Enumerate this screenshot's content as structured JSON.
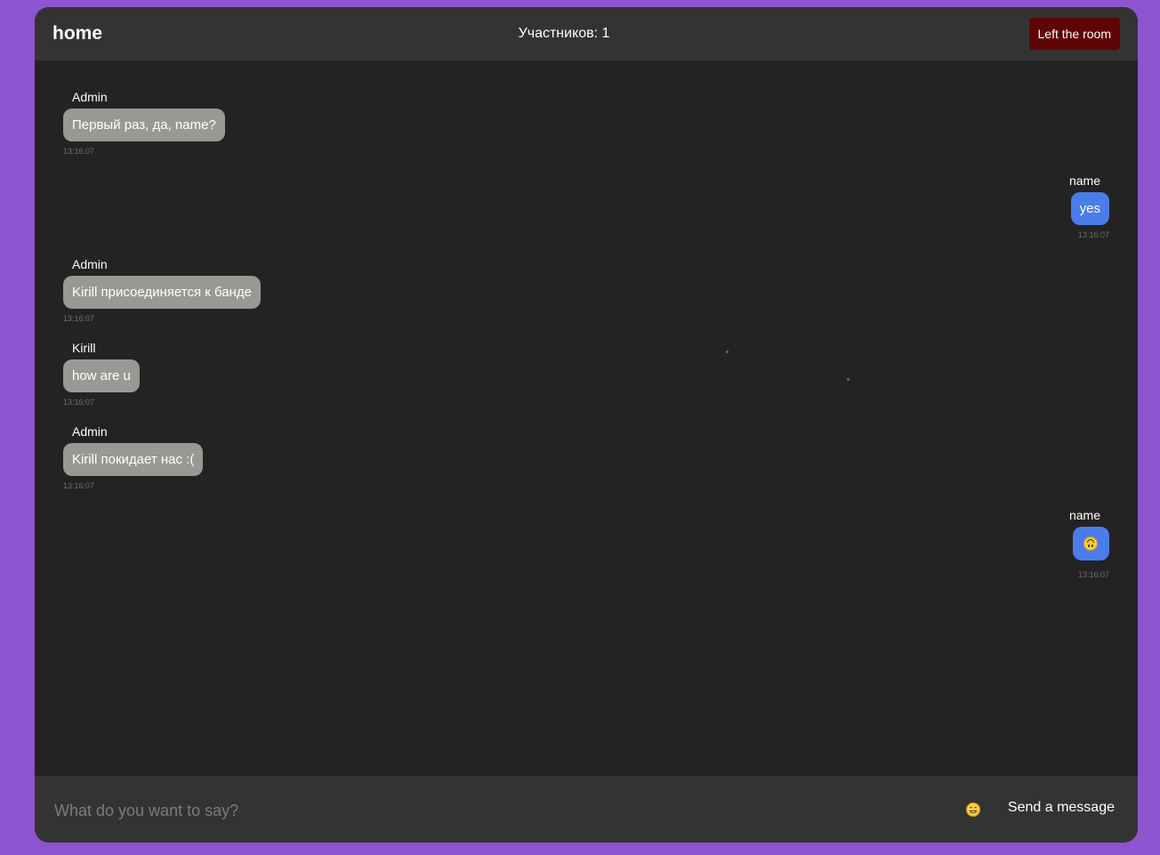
{
  "header": {
    "room_name": "home",
    "participants_label": "Участников: 1",
    "leave_label": "Left the room"
  },
  "messages": [
    {
      "author": "Admin",
      "text": "Первый раз, да, name?",
      "time": "13:16:07",
      "side": "left"
    },
    {
      "author": "name",
      "text": "yes",
      "time": "13:16:07",
      "side": "right"
    },
    {
      "author": "Admin",
      "text": "Kirill присоединяется к банде",
      "time": "13:16:07",
      "side": "left"
    },
    {
      "author": "Kirill",
      "text": "how are u",
      "time": "13:16:07",
      "side": "left"
    },
    {
      "author": "Admin",
      "text": "Kirill покидает нас :(",
      "time": "13:16:07",
      "side": "left"
    },
    {
      "author": "name",
      "emoji": "upside-down-face-icon",
      "time": "13:16:07",
      "side": "right"
    }
  ],
  "composer": {
    "placeholder": "What do you want to say?",
    "value": "",
    "emoji_button_icon": "grinning-face-icon",
    "send_label": "Send a message"
  },
  "colors": {
    "page_background": "#8e54d0",
    "window_background": "#232323",
    "bar_background": "#333333",
    "incoming_bubble": "#9a9895",
    "outgoing_bubble": "#4a7de9",
    "leave_button": "#5e0404"
  }
}
